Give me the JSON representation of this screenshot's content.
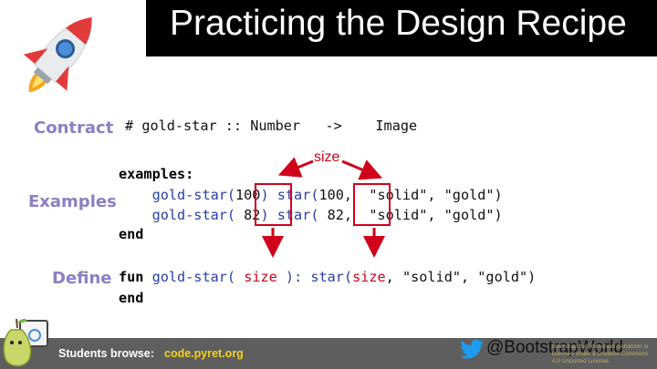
{
  "title": "Practicing the Design Recipe",
  "labels": {
    "contract": "Contract",
    "examples": "Examples",
    "define": "Define"
  },
  "contract": {
    "comment": "#",
    "name": "gold-star",
    "sep": "::",
    "domain": "Number",
    "arrow": "->",
    "range": "Image"
  },
  "examples": {
    "open": "examples:",
    "rows": [
      {
        "fn": "gold-star(",
        "arg": "100",
        "close": ")",
        "star": "star(",
        "arg2": "100,",
        "args": "\"solid\", \"gold\")"
      },
      {
        "fn": "gold-star(",
        "arg": " 82",
        "close": ")",
        "star": "star(",
        "arg2": " 82,",
        "args": "\"solid\", \"gold\")"
      }
    ],
    "end": "end"
  },
  "define": {
    "kw": "fun",
    "fn": "gold-star(",
    "param": "size",
    "close": "):",
    "star": "star(",
    "param2": "size",
    "comma": ",",
    "args": "\"solid\", \"gold\")",
    "end": "end"
  },
  "annotation": {
    "size_label": "size"
  },
  "footer": {
    "browse_label": "Students browse:",
    "browse_link": "code.pyret.org",
    "twitter": "@BootstrapWorld",
    "license": "Bootstrap by Emmanuel Schanzer is licensed under a Creative Commons 4.0 Unported License."
  },
  "colors": {
    "accent": "#d0021b",
    "label": "#8c7fc4",
    "function": "#2a3ea8",
    "footer_bg": "#5e5e5e",
    "link": "#f2d21b"
  },
  "icons": [
    "rocket-icon",
    "pear-mascot-icon",
    "twitter-bird-icon"
  ]
}
